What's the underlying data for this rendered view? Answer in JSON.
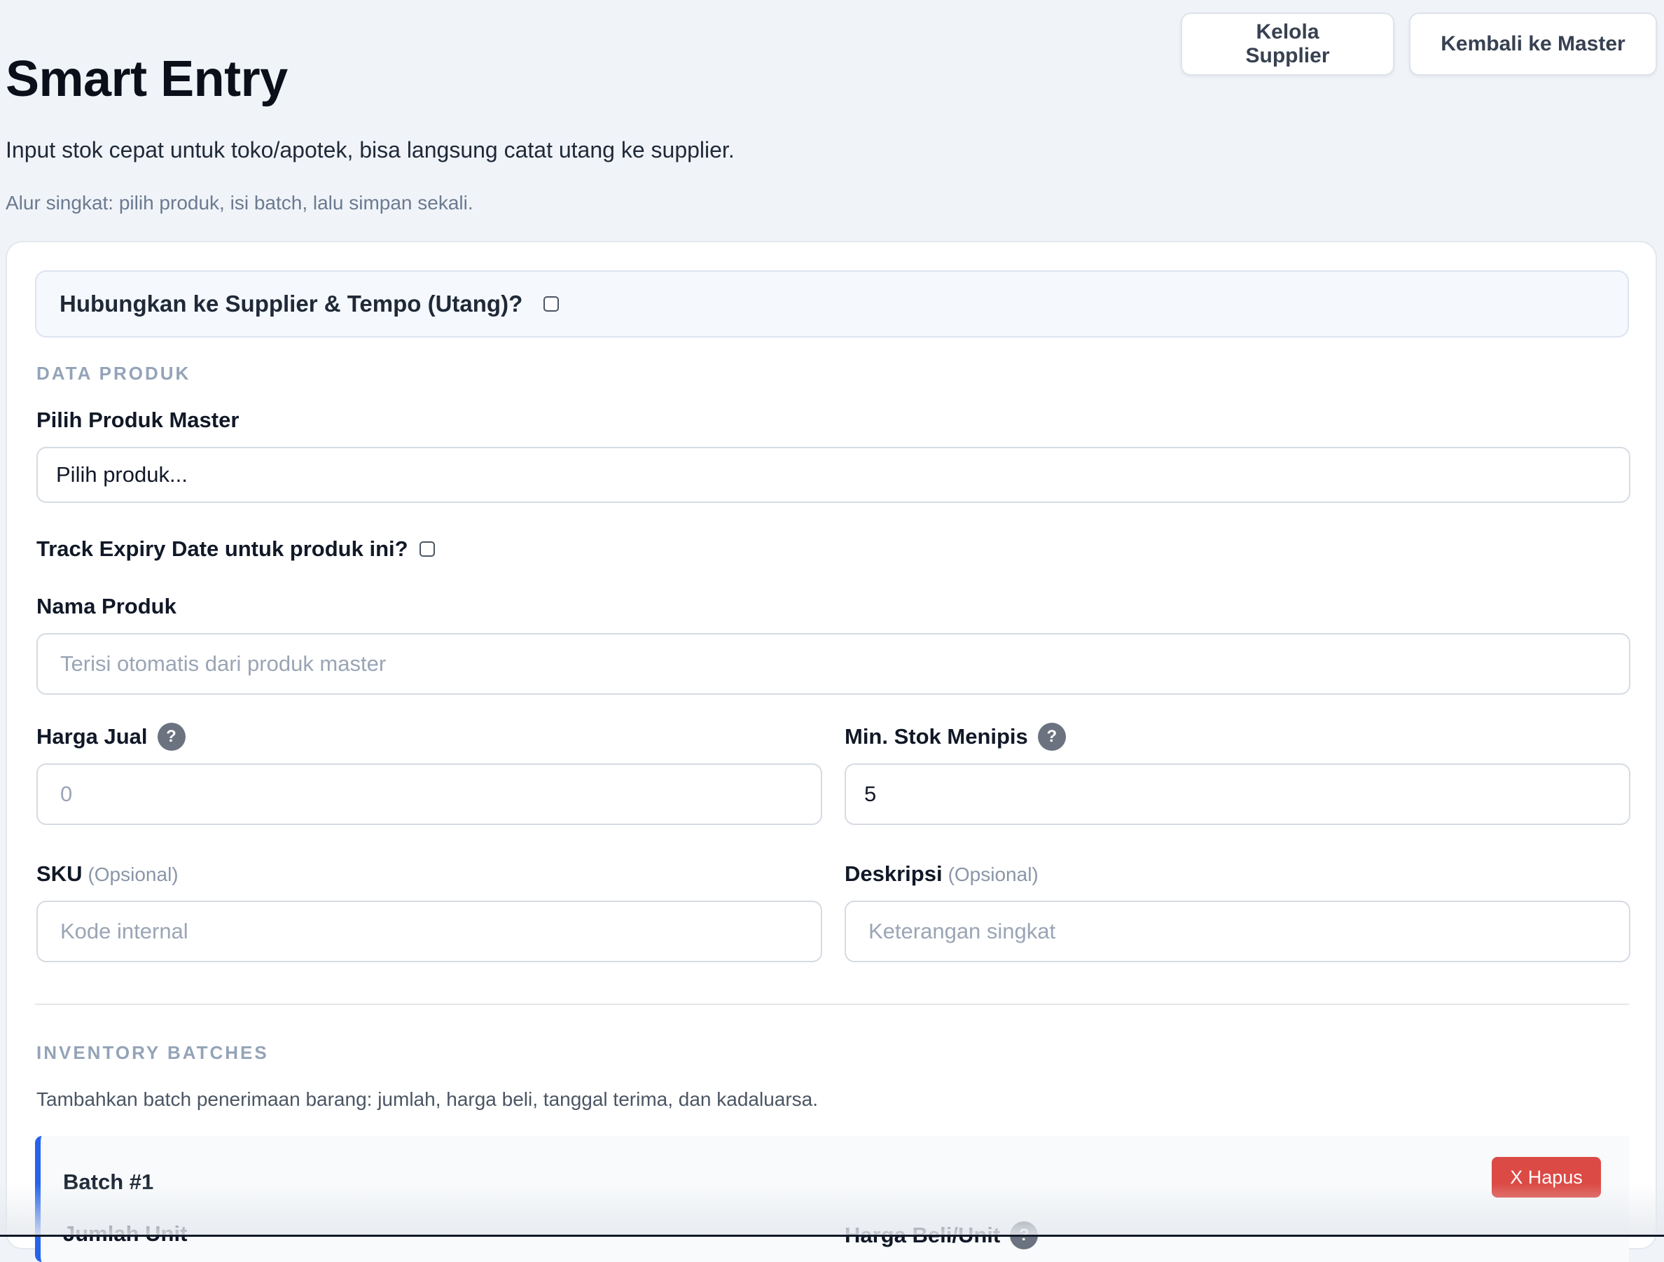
{
  "header": {
    "title": "Smart Entry",
    "subtitle": "Input stok cepat untuk toko/apotek, bisa langsung catat utang ke supplier.",
    "hint": "Alur singkat: pilih produk, isi batch, lalu simpan sekali.",
    "buttons": {
      "manage_supplier": "Kelola Supplier",
      "back_to_master": "Kembali ke Master"
    }
  },
  "supplier_link": {
    "label": "Hubungkan ke Supplier & Tempo (Utang)?",
    "checked": false
  },
  "product_section": {
    "title": "DATA PRODUK",
    "master_product": {
      "label": "Pilih Produk Master",
      "value": "Pilih produk..."
    },
    "track_expiry": {
      "label": "Track Expiry Date untuk produk ini?",
      "checked": false
    },
    "product_name": {
      "label": "Nama Produk",
      "placeholder": "Terisi otomatis dari produk master"
    },
    "sell_price": {
      "label": "Harga Jual",
      "placeholder": "0"
    },
    "min_stock": {
      "label": "Min. Stok Menipis",
      "value": "5"
    },
    "sku": {
      "label": "SKU",
      "optional": "(Opsional)",
      "placeholder": "Kode internal"
    },
    "description": {
      "label": "Deskripsi",
      "optional": "(Opsional)",
      "placeholder": "Keterangan singkat"
    }
  },
  "batch_section": {
    "title": "INVENTORY BATCHES",
    "description": "Tambahkan batch penerimaan barang: jumlah, harga beli, tanggal terima, dan kadaluarsa.",
    "batches": [
      {
        "title": "Batch #1",
        "delete_label": "X Hapus",
        "qty_label": "Jumlah Unit",
        "buy_price_label": "Harga Beli/Unit"
      }
    ]
  },
  "help_icon_glyph": "?"
}
